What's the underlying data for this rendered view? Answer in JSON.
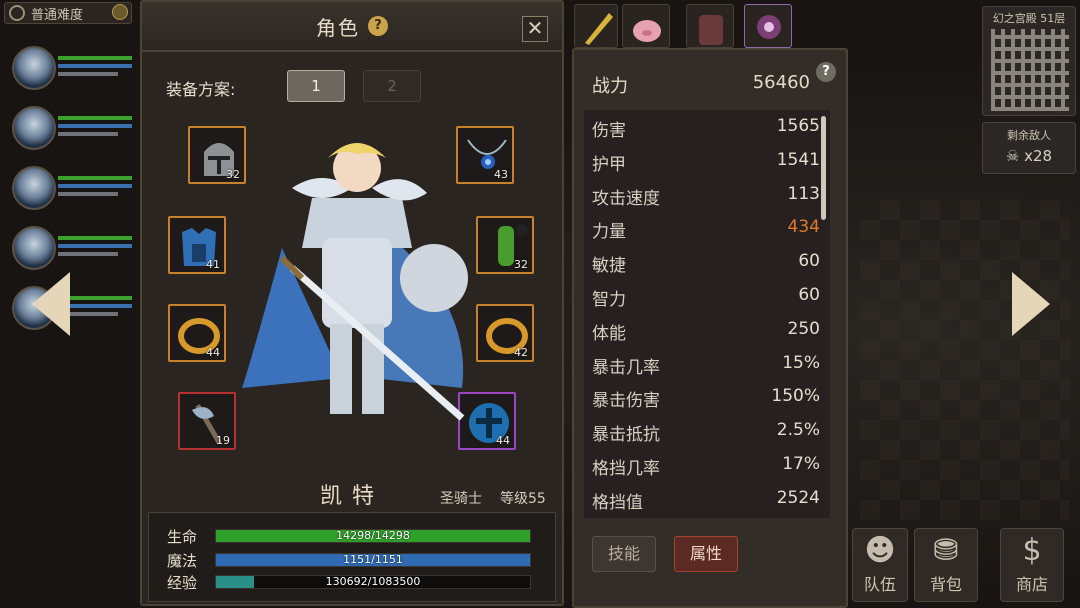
{
  "difficulty": {
    "label": "普通难度"
  },
  "minimap": {
    "title": "幻之宫殿 51层"
  },
  "enemies": {
    "label": "剩余敌人",
    "count": "x28"
  },
  "bottom_nav": {
    "team": "队伍",
    "bag": "背包",
    "shop": "商店"
  },
  "panel": {
    "title": "角色",
    "help_glyph": "?",
    "close_glyph": "✕",
    "loadout_label": "装备方案:",
    "loadouts": [
      "1",
      "2"
    ],
    "equipment": [
      {
        "slot": "helmet",
        "level": "32"
      },
      {
        "slot": "necklace",
        "level": "43"
      },
      {
        "slot": "armor",
        "level": "41"
      },
      {
        "slot": "gloves",
        "level": "32"
      },
      {
        "slot": "ring-left",
        "level": "44"
      },
      {
        "slot": "ring-right",
        "level": "42"
      },
      {
        "slot": "weapon",
        "level": "19"
      },
      {
        "slot": "shield",
        "level": "44"
      }
    ],
    "hero": {
      "name": "凯特",
      "class": "圣骑士",
      "level": "等级55"
    },
    "stats": {
      "hp": {
        "label": "生命",
        "text": "14298/14298",
        "fraction": 1.0,
        "color": "#2fa12a"
      },
      "mp": {
        "label": "魔法",
        "text": "1151/1151",
        "fraction": 1.0,
        "color": "#2e6bb3"
      },
      "xp": {
        "label": "经验",
        "text": "130692/1083500",
        "fraction": 0.121,
        "color": "#2a8f86"
      }
    }
  },
  "attributes": {
    "power": {
      "label": "战力",
      "value": "56460"
    },
    "rows": [
      {
        "label": "伤害",
        "value": "1565"
      },
      {
        "label": "护甲",
        "value": "1541"
      },
      {
        "label": "攻击速度",
        "value": "113"
      },
      {
        "label": "力量",
        "value": "434",
        "highlight": true
      },
      {
        "label": "敏捷",
        "value": "60"
      },
      {
        "label": "智力",
        "value": "60"
      },
      {
        "label": "体能",
        "value": "250"
      },
      {
        "label": "暴击几率",
        "value": "15%"
      },
      {
        "label": "暴击伤害",
        "value": "150%"
      },
      {
        "label": "暴击抵抗",
        "value": "2.5%"
      },
      {
        "label": "格挡几率",
        "value": "17%"
      },
      {
        "label": "格挡值",
        "value": "2524"
      }
    ],
    "tabs": {
      "skill": "技能",
      "attr": "属性"
    },
    "highlight_color": "#e07a2b"
  }
}
